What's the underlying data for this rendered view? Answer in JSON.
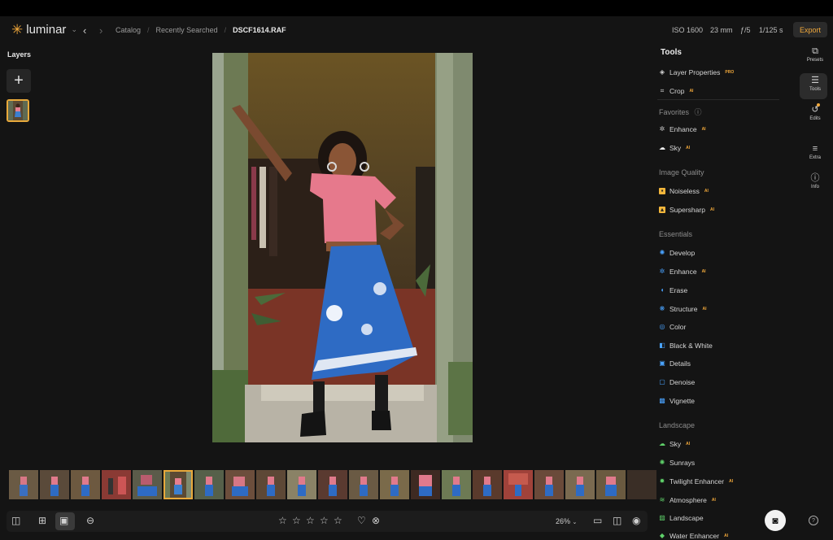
{
  "app": {
    "logo_text": "luminar",
    "accent": "#f2a93b"
  },
  "breadcrumb": {
    "catalog": "Catalog",
    "recent": "Recently Searched",
    "file": "DSCF1614.RAF"
  },
  "exif": {
    "iso": "ISO 1600",
    "focal": "23 mm",
    "aperture": "ƒ/5",
    "shutter": "1/125 s"
  },
  "header": {
    "export_label": "Export"
  },
  "layers": {
    "title": "Layers",
    "add_label": "+"
  },
  "tools": {
    "title": "Tools",
    "top": [
      {
        "label": "Layer Properties",
        "tag": "PRO",
        "icon": "layers-icon"
      },
      {
        "label": "Crop",
        "tag": "AI",
        "icon": "crop-icon"
      }
    ],
    "favorites_title": "Favorites",
    "favorites": [
      {
        "label": "Enhance",
        "tag": "AI",
        "icon": "enhance-icon"
      },
      {
        "label": "Sky",
        "tag": "AI",
        "icon": "cloud-icon"
      }
    ],
    "image_quality_title": "Image Quality",
    "image_quality": [
      {
        "label": "Noiseless",
        "tag": "AI",
        "icon": "noiseless-icon"
      },
      {
        "label": "Supersharp",
        "tag": "AI",
        "icon": "supersharp-icon"
      }
    ],
    "essentials_title": "Essentials",
    "essentials": [
      {
        "label": "Develop",
        "tag": "",
        "icon": "develop-icon"
      },
      {
        "label": "Enhance",
        "tag": "AI",
        "icon": "enhance-icon"
      },
      {
        "label": "Erase",
        "tag": "",
        "icon": "erase-icon"
      },
      {
        "label": "Structure",
        "tag": "AI",
        "icon": "structure-icon"
      },
      {
        "label": "Color",
        "tag": "",
        "icon": "color-icon"
      },
      {
        "label": "Black & White",
        "tag": "",
        "icon": "bw-icon"
      },
      {
        "label": "Details",
        "tag": "",
        "icon": "details-icon"
      },
      {
        "label": "Denoise",
        "tag": "",
        "icon": "denoise-icon"
      },
      {
        "label": "Vignette",
        "tag": "",
        "icon": "vignette-icon"
      }
    ],
    "landscape_title": "Landscape",
    "landscape": [
      {
        "label": "Sky",
        "tag": "AI",
        "icon": "cloud-icon"
      },
      {
        "label": "Sunrays",
        "tag": "",
        "icon": "sunrays-icon"
      },
      {
        "label": "Twilight Enhancer",
        "tag": "AI",
        "icon": "twilight-icon"
      },
      {
        "label": "Atmosphere",
        "tag": "AI",
        "icon": "atmosphere-icon"
      },
      {
        "label": "Landscape",
        "tag": "",
        "icon": "landscape-icon"
      },
      {
        "label": "Water Enhancer",
        "tag": "AI",
        "icon": "water-icon"
      }
    ]
  },
  "rail": {
    "presets": "Presets",
    "tools": "Tools",
    "edits": "Edits",
    "extra": "Extra",
    "info": "Info"
  },
  "bottom": {
    "zoom": "26%",
    "rating": 0,
    "rating_max": 5
  }
}
